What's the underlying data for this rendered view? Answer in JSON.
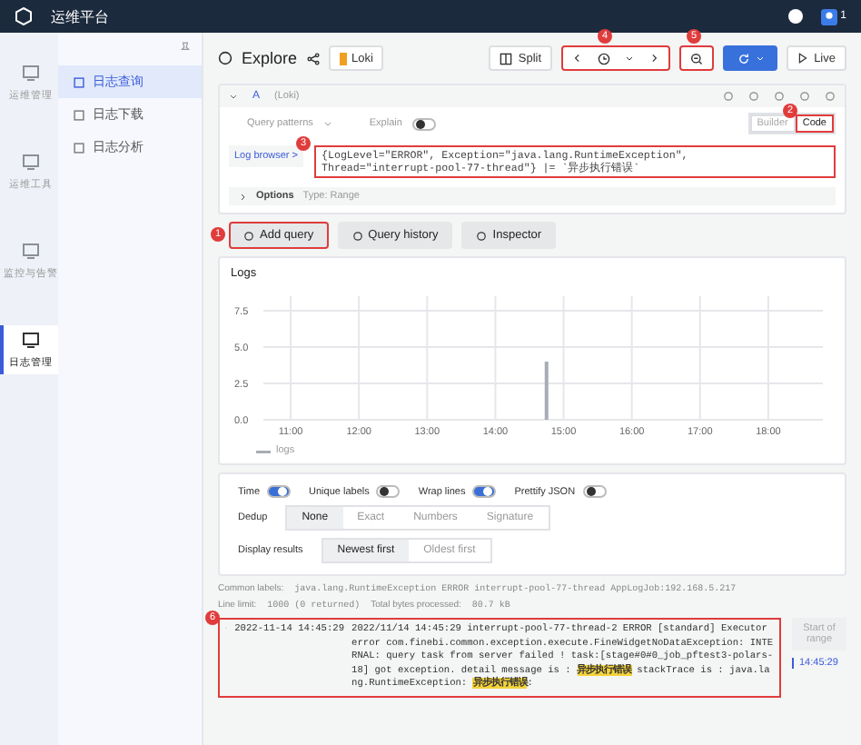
{
  "topbar": {
    "title": "运维平台",
    "user": "1"
  },
  "rail": [
    {
      "label": "运维管理",
      "selected": false
    },
    {
      "label": "运维工具",
      "selected": false
    },
    {
      "label": "监控与告警",
      "selected": false
    },
    {
      "label": "日志管理",
      "selected": true
    }
  ],
  "subnav": [
    {
      "label": "日志查询",
      "selected": true
    },
    {
      "label": "日志下载",
      "selected": false
    },
    {
      "label": "日志分析",
      "selected": false
    }
  ],
  "explore": {
    "title": "Explore",
    "datasource": "Loki",
    "split": "Split",
    "live": "Live",
    "time_marker": "4",
    "zoom_marker": "5"
  },
  "query": {
    "name": "A",
    "source": "(Loki)",
    "patterns": "Query patterns",
    "explain": "Explain",
    "explain_on": false,
    "modes": [
      {
        "label": "Builder",
        "selected": false
      },
      {
        "label": "Code",
        "selected": true
      }
    ],
    "mode_marker": "2",
    "log_browser": "Log browser >",
    "code": [
      "{LogLevel=\"ERROR\", Exception=\"java.lang.RuntimeException\",",
      "Thread=\"interrupt-pool-77-thread\"} |= `异步执行错误`"
    ],
    "code_marker": "3",
    "options": "Options",
    "options_value": "Type: Range"
  },
  "actions": [
    {
      "label": "Add query",
      "marker": "1"
    },
    {
      "label": "Query history"
    },
    {
      "label": "Inspector"
    }
  ],
  "logs_panel": {
    "title": "Logs",
    "chart_data": {
      "type": "bar",
      "grid": true,
      "x": [
        14.75
      ],
      "series": [
        {
          "name": "logs",
          "color": "#a8adb5",
          "values": [
            4
          ]
        }
      ],
      "xlim": [
        10.6,
        18.8
      ],
      "ylim": [
        0,
        8.5
      ],
      "xticks": [
        {
          "value": 11,
          "label": "11:00"
        },
        {
          "value": 12,
          "label": "12:00"
        },
        {
          "value": 13,
          "label": "13:00"
        },
        {
          "value": 14,
          "label": "14:00"
        },
        {
          "value": 15,
          "label": "15:00"
        },
        {
          "value": 16,
          "label": "16:00"
        },
        {
          "value": 17,
          "label": "17:00"
        },
        {
          "value": 18,
          "label": "18:00"
        }
      ],
      "yticks": [
        {
          "value": 0,
          "label": "0.0"
        },
        {
          "value": 2.5,
          "label": "2.5"
        },
        {
          "value": 5,
          "label": "5.0"
        },
        {
          "value": 7.5,
          "label": "7.5"
        }
      ]
    }
  },
  "toggles": [
    {
      "label": "Time",
      "on": true
    },
    {
      "label": "Unique labels",
      "on": false
    },
    {
      "label": "Wrap lines",
      "on": true
    },
    {
      "label": "Prettify JSON",
      "on": false
    }
  ],
  "dedup": {
    "label": "Dedup",
    "options": [
      {
        "label": "None",
        "selected": true
      },
      {
        "label": "Exact",
        "selected": false
      },
      {
        "label": "Numbers",
        "selected": false
      },
      {
        "label": "Signature",
        "selected": false
      }
    ]
  },
  "display": {
    "label": "Display results",
    "options": [
      {
        "label": "Newest first",
        "selected": true
      },
      {
        "label": "Oldest first",
        "selected": false
      }
    ]
  },
  "meta": [
    {
      "label": "Common labels:",
      "value": "java.lang.RuntimeException ERROR interrupt-pool-77-thread AppLogJob:192.168.5.217"
    },
    {
      "label": "Line limit:",
      "value": "1000 (0 returned)"
    },
    {
      "label": "Total bytes processed:",
      "value": "80.7 kB"
    }
  ],
  "log_row": {
    "marker": "6",
    "time": "2022-11-14 14:45:29",
    "message": "2022/11/14 14:45:29 interrupt-pool-77-thread-2 ERROR [standard]  Executor error com.finebi.common.exception.execute.FineWidgetNoDataException: INTERNAL: query task from server failed ! task:[stage#0#0_job_pftest3-polars-18] got exception. detail message is : **异步执行错误**  stackTrace is : java.lang.RuntimeException: **异步执行错误**:"
  },
  "range": {
    "label": "Start of range",
    "time": "14:45:29"
  }
}
